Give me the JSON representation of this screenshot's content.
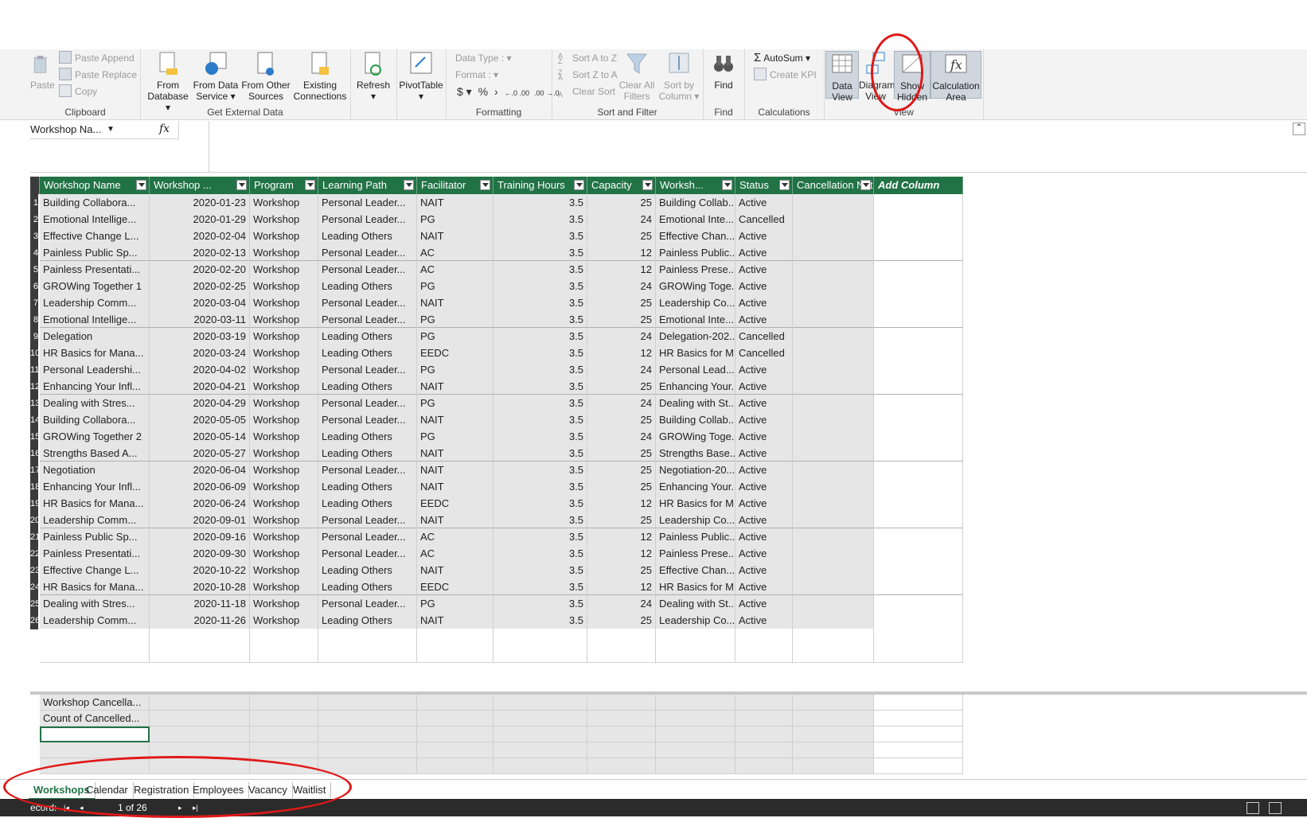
{
  "ribbon": {
    "clipboard": {
      "label": "Clipboard",
      "paste": "Paste",
      "paste_append": "Paste Append",
      "paste_replace": "Paste Replace",
      "copy": "Copy"
    },
    "external": {
      "label": "Get External Data",
      "from_db": "From Database",
      "from_service": "From Data Service",
      "from_other": "From Other Sources",
      "existing": "Existing Connections"
    },
    "refresh": "Refresh",
    "pivot": "PivotTable",
    "formatting": {
      "label": "Formatting",
      "data_type": "Data Type :",
      "format": "Format :",
      "dollar": "$",
      "percent": "%",
      "comma": "›",
      "inc_dec": "←.0 .00",
      "dec_dec": ".00 →.0"
    },
    "sort": {
      "label": "Sort and Filter",
      "az": "Sort A to Z",
      "za": "Sort Z to A",
      "clear_sort": "Clear Sort",
      "clear_filters": "Clear All Filters",
      "by_column": "Sort by Column"
    },
    "find": {
      "label": "Find",
      "button": "Find"
    },
    "calculations": {
      "label": "Calculations",
      "autosum": "AutoSum",
      "kpi": "Create KPI"
    },
    "view": {
      "label": "View",
      "data_view": "Data View",
      "diagram_view": "Diagram View",
      "show_hidden": "Show Hidden",
      "calc_area": "Calculation Area"
    }
  },
  "formula_bar": {
    "name_box": "Workshop Na...",
    "fx": "fx"
  },
  "columns": [
    "Workshop Name",
    "Workshop ...",
    "Program",
    "Learning Path",
    "Facilitator",
    "Training Hours",
    "Capacity",
    "Worksh...",
    "Status",
    "Cancellation Notes",
    "Add Column"
  ],
  "rows": [
    [
      "1",
      "Building Collabora...",
      "2020-01-23",
      "Workshop",
      "Personal Leader...",
      "NAIT",
      "3.5",
      "25",
      "Building Collab...",
      "Active"
    ],
    [
      "2",
      "Emotional Intellige...",
      "2020-01-29",
      "Workshop",
      "Personal Leader...",
      "PG",
      "3.5",
      "24",
      "Emotional Inte...",
      "Cancelled"
    ],
    [
      "3",
      "Effective Change L...",
      "2020-02-04",
      "Workshop",
      "Leading Others",
      "NAIT",
      "3.5",
      "25",
      "Effective Chan...",
      "Active"
    ],
    [
      "4",
      "Painless Public Sp...",
      "2020-02-13",
      "Workshop",
      "Personal Leader...",
      "AC",
      "3.5",
      "12",
      "Painless Public...",
      "Active"
    ],
    [
      "5",
      "Painless Presentati...",
      "2020-02-20",
      "Workshop",
      "Personal Leader...",
      "AC",
      "3.5",
      "12",
      "Painless Prese...",
      "Active"
    ],
    [
      "6",
      "GROWing Together 1",
      "2020-02-25",
      "Workshop",
      "Leading Others",
      "PG",
      "3.5",
      "24",
      "GROWing Toge...",
      "Active"
    ],
    [
      "7",
      "Leadership Comm...",
      "2020-03-04",
      "Workshop",
      "Personal Leader...",
      "NAIT",
      "3.5",
      "25",
      "Leadership Co...",
      "Active"
    ],
    [
      "8",
      "Emotional Intellige...",
      "2020-03-11",
      "Workshop",
      "Personal Leader...",
      "PG",
      "3.5",
      "25",
      "Emotional Inte...",
      "Active"
    ],
    [
      "9",
      "Delegation",
      "2020-03-19",
      "Workshop",
      "Leading Others",
      "PG",
      "3.5",
      "24",
      "Delegation-202...",
      "Cancelled"
    ],
    [
      "10",
      "HR Basics for Mana...",
      "2020-03-24",
      "Workshop",
      "Leading Others",
      "EEDC",
      "3.5",
      "12",
      "HR Basics for M...",
      "Cancelled"
    ],
    [
      "11",
      "Personal Leadershi...",
      "2020-04-02",
      "Workshop",
      "Personal Leader...",
      "PG",
      "3.5",
      "24",
      "Personal Lead...",
      "Active"
    ],
    [
      "12",
      "Enhancing Your Infl...",
      "2020-04-21",
      "Workshop",
      "Leading Others",
      "NAIT",
      "3.5",
      "25",
      "Enhancing Your...",
      "Active"
    ],
    [
      "13",
      "Dealing with Stres...",
      "2020-04-29",
      "Workshop",
      "Personal Leader...",
      "PG",
      "3.5",
      "24",
      "Dealing with St...",
      "Active"
    ],
    [
      "14",
      "Building Collabora...",
      "2020-05-05",
      "Workshop",
      "Personal Leader...",
      "NAIT",
      "3.5",
      "25",
      "Building Collab...",
      "Active"
    ],
    [
      "15",
      "GROWing Together 2",
      "2020-05-14",
      "Workshop",
      "Leading Others",
      "PG",
      "3.5",
      "24",
      "GROWing Toge...",
      "Active"
    ],
    [
      "16",
      "Strengths Based A...",
      "2020-05-27",
      "Workshop",
      "Leading Others",
      "NAIT",
      "3.5",
      "25",
      "Strengths Base...",
      "Active"
    ],
    [
      "17",
      "Negotiation",
      "2020-06-04",
      "Workshop",
      "Personal Leader...",
      "NAIT",
      "3.5",
      "25",
      "Negotiation-20...",
      "Active"
    ],
    [
      "18",
      "Enhancing Your Infl...",
      "2020-06-09",
      "Workshop",
      "Leading Others",
      "NAIT",
      "3.5",
      "25",
      "Enhancing Your...",
      "Active"
    ],
    [
      "19",
      "HR Basics for Mana...",
      "2020-06-24",
      "Workshop",
      "Leading Others",
      "EEDC",
      "3.5",
      "12",
      "HR Basics for M...",
      "Active"
    ],
    [
      "20",
      "Leadership Comm...",
      "2020-09-01",
      "Workshop",
      "Personal Leader...",
      "NAIT",
      "3.5",
      "25",
      "Leadership Co...",
      "Active"
    ],
    [
      "21",
      "Painless Public Sp...",
      "2020-09-16",
      "Workshop",
      "Personal Leader...",
      "AC",
      "3.5",
      "12",
      "Painless Public...",
      "Active"
    ],
    [
      "22",
      "Painless Presentati...",
      "2020-09-30",
      "Workshop",
      "Personal Leader...",
      "AC",
      "3.5",
      "12",
      "Painless Prese...",
      "Active"
    ],
    [
      "23",
      "Effective Change L...",
      "2020-10-22",
      "Workshop",
      "Leading Others",
      "NAIT",
      "3.5",
      "25",
      "Effective Chan...",
      "Active"
    ],
    [
      "24",
      "HR Basics for Mana...",
      "2020-10-28",
      "Workshop",
      "Leading Others",
      "EEDC",
      "3.5",
      "12",
      "HR Basics for M...",
      "Active"
    ],
    [
      "25",
      "Dealing with Stres...",
      "2020-11-18",
      "Workshop",
      "Personal Leader...",
      "PG",
      "3.5",
      "24",
      "Dealing with St...",
      "Active"
    ],
    [
      "26",
      "Leadership Comm...",
      "2020-11-26",
      "Workshop",
      "Leading Others",
      "NAIT",
      "3.5",
      "25",
      "Leadership Co...",
      "Active"
    ]
  ],
  "calc_area": {
    "measure1": "Workshop Cancella...",
    "measure2": "Count of Cancelled..."
  },
  "tabs": [
    "Workshops",
    "Calendar",
    "Registration",
    "Employees",
    "Vacancy",
    "Waitlist"
  ],
  "status": {
    "record_label": "ecord:",
    "record_pos": "1 of 26"
  },
  "colors": {
    "header_green": "#217346",
    "annotation_red": "#e01818"
  }
}
